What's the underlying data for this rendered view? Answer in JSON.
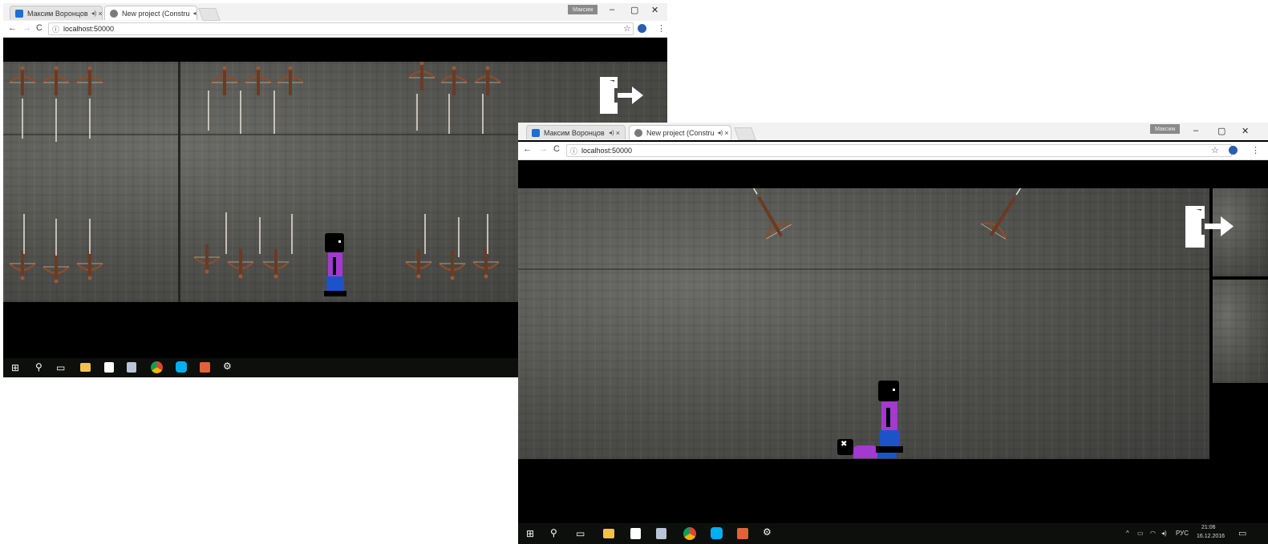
{
  "window1": {
    "tabs": [
      {
        "title": "Максим Воронцов",
        "favicon_color": "#1c6fd1"
      },
      {
        "title": "New project (Constru",
        "favicon_color": "#7a7a7a"
      }
    ],
    "user_badge": "Максим",
    "address": "localhost:50000",
    "window_controls": {
      "minimize": "–",
      "maximize": "▢",
      "close": "✕"
    }
  },
  "window2": {
    "tabs": [
      {
        "title": "Максим Воронцов",
        "favicon_color": "#1c6fd1"
      },
      {
        "title": "New project (Constru",
        "favicon_color": "#7a7a7a"
      }
    ],
    "user_badge": "Максим",
    "address": "localhost:50000",
    "window_controls": {
      "minimize": "–",
      "maximize": "▢",
      "close": "✕"
    },
    "tray": {
      "language": "РУС",
      "time": "21:06",
      "date": "16.12.2016"
    }
  },
  "icons": {
    "back": "back-arrow-icon",
    "forward": "forward-arrow-icon",
    "reload": "reload-icon",
    "info": "info-icon",
    "bookmark": "star-icon",
    "extension": "extension-icon",
    "menu": "menu-dots-icon",
    "exit": "exit-door-icon",
    "taskbar": [
      "windows-start-icon",
      "search-icon",
      "task-view-icon",
      "file-explorer-icon",
      "store-icon",
      "notes-icon",
      "chrome-icon",
      "skype-icon",
      "paint-icon",
      "settings-icon"
    ]
  },
  "colors": {
    "player_body": "#a23ad0",
    "player_legs": "#1d53c8",
    "player_head": "#000000",
    "crossbow_wood": "#8a4d2c",
    "arrow": "#e8e4d8",
    "wall": "#55554f"
  }
}
